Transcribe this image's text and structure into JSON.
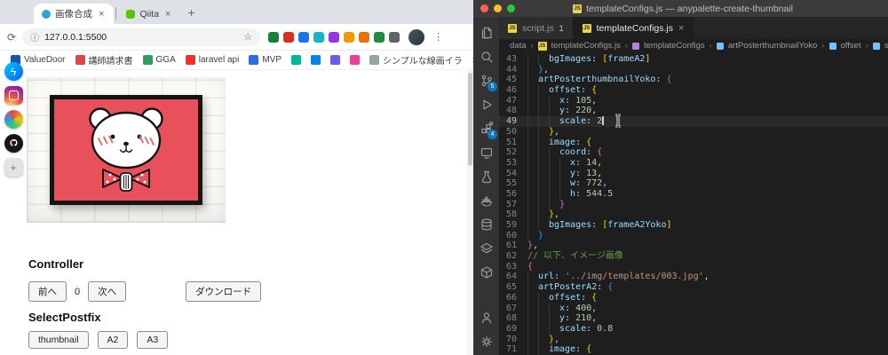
{
  "browser": {
    "tabs": [
      {
        "title": "画像合成",
        "favicon_color": "#2ea8c7"
      },
      {
        "title": "Qiita",
        "favicon_color": "#55c500"
      }
    ],
    "new_tab_label": "+",
    "url": "127.0.0.1:5500",
    "info_icon": "ⓘ",
    "star_icon": "☆",
    "reload_icon": "⟳",
    "menu_icon": "⋮",
    "extension_colors": [
      "#188038",
      "#d93025",
      "#1a73e8",
      "#12b5cb",
      "#9334e6",
      "#f29900",
      "#e8710a",
      "#1e8e3e",
      "#5f6368"
    ],
    "bookmarks": [
      {
        "label": "ValueDoor",
        "color": "#1a56a8"
      },
      {
        "label": "講師請求書",
        "color": "#e04545"
      },
      {
        "label": "GGA",
        "color": "#2e9e5b"
      },
      {
        "label": "laravel api",
        "color": "#ff2d20"
      },
      {
        "label": "MVP",
        "color": "#2d6cdf"
      },
      {
        "label": "",
        "color": "#00b894"
      },
      {
        "label": "",
        "color": "#0984e3"
      },
      {
        "label": "",
        "color": "#6c5ce7"
      },
      {
        "label": "",
        "color": "#e84393"
      },
      {
        "label": "シンプルな線画イラ",
        "color": "#95a5a6"
      },
      {
        "label": "»",
        "color": ""
      }
    ],
    "page": {
      "controller_heading": "Controller",
      "prev_button": "前へ",
      "counter": "0",
      "next_button": "次へ",
      "download_button": "ダウンロード",
      "postfix_heading": "SelectPostfix",
      "postfix_buttons": [
        "thumbnail",
        "A2",
        "A3"
      ]
    }
  },
  "dock": {
    "items": [
      "messenger",
      "instagram",
      "mission-control",
      "github",
      "add"
    ]
  },
  "vscode": {
    "window_title": "templateConfigs.js — anypalette-create-thumbnail",
    "tabs": [
      {
        "label": "script.js",
        "badge": "1"
      },
      {
        "label": "templateConfigs.js",
        "close": "×"
      }
    ],
    "breadcrumbs": [
      "data",
      "templateConfigs.js",
      "templateConfigs",
      "artPosterthumbnailYoko",
      "offset",
      "scale"
    ],
    "activity_badges": {
      "scm": "5",
      "extensions": "4"
    },
    "colors": {
      "k": "#9cdcfe",
      "n": "#b5cea8",
      "s": "#ce9178",
      "c": "#6a9955",
      "p": "#d4d4d4",
      "b1": "#ffd700",
      "b2": "#da70d6",
      "b3": "#179fff",
      "accent": "#1177bb",
      "editor_bg": "#1e1e1e"
    },
    "code": {
      "lines": [
        {
          "n": 43,
          "i": 4,
          "t": [
            [
              "k",
              "bgImages"
            ],
            [
              "p",
              ": "
            ],
            [
              "b1",
              "["
            ],
            [
              "k",
              "frameA2"
            ],
            [
              "b1",
              "]"
            ]
          ]
        },
        {
          "n": 44,
          "i": 2,
          "t": [
            [
              "b3",
              "}"
            ],
            [
              "p",
              ","
            ]
          ]
        },
        {
          "n": 45,
          "i": 2,
          "t": [
            [
              "k",
              "artPosterthumbnailYoko"
            ],
            [
              "p",
              ": "
            ],
            [
              "b3",
              "{"
            ]
          ]
        },
        {
          "n": 46,
          "i": 4,
          "t": [
            [
              "k",
              "offset"
            ],
            [
              "p",
              ": "
            ],
            [
              "b1",
              "{"
            ]
          ]
        },
        {
          "n": 47,
          "i": 6,
          "t": [
            [
              "k",
              "x"
            ],
            [
              "p",
              ": "
            ],
            [
              "n",
              "105"
            ],
            [
              "p",
              ","
            ]
          ]
        },
        {
          "n": 48,
          "i": 6,
          "t": [
            [
              "k",
              "y"
            ],
            [
              "p",
              ": "
            ],
            [
              "n",
              "220"
            ],
            [
              "p",
              ","
            ]
          ]
        },
        {
          "n": 49,
          "i": 6,
          "cur": true,
          "t": [
            [
              "k",
              "scale"
            ],
            [
              "p",
              ": "
            ],
            [
              "n",
              "2"
            ]
          ]
        },
        {
          "n": 50,
          "i": 4,
          "t": [
            [
              "b1",
              "}"
            ],
            [
              "p",
              ","
            ]
          ]
        },
        {
          "n": 51,
          "i": 4,
          "t": [
            [
              "k",
              "image"
            ],
            [
              "p",
              ": "
            ],
            [
              "b1",
              "{"
            ]
          ]
        },
        {
          "n": 52,
          "i": 6,
          "t": [
            [
              "k",
              "coord"
            ],
            [
              "p",
              ": "
            ],
            [
              "b2",
              "{"
            ]
          ]
        },
        {
          "n": 53,
          "i": 8,
          "t": [
            [
              "k",
              "x"
            ],
            [
              "p",
              ": "
            ],
            [
              "n",
              "14"
            ],
            [
              "p",
              ","
            ]
          ]
        },
        {
          "n": 54,
          "i": 8,
          "t": [
            [
              "k",
              "y"
            ],
            [
              "p",
              ": "
            ],
            [
              "n",
              "13"
            ],
            [
              "p",
              ","
            ]
          ]
        },
        {
          "n": 55,
          "i": 8,
          "t": [
            [
              "k",
              "w"
            ],
            [
              "p",
              ": "
            ],
            [
              "n",
              "772"
            ],
            [
              "p",
              ","
            ]
          ]
        },
        {
          "n": 56,
          "i": 8,
          "t": [
            [
              "k",
              "h"
            ],
            [
              "p",
              ": "
            ],
            [
              "n",
              "544.5"
            ]
          ]
        },
        {
          "n": 57,
          "i": 6,
          "t": [
            [
              "b2",
              "}"
            ]
          ]
        },
        {
          "n": 58,
          "i": 4,
          "t": [
            [
              "b1",
              "}"
            ],
            [
              "p",
              ","
            ]
          ]
        },
        {
          "n": 59,
          "i": 4,
          "t": [
            [
              "k",
              "bgImages"
            ],
            [
              "p",
              ": "
            ],
            [
              "b1",
              "["
            ],
            [
              "k",
              "frameA2Yoko"
            ],
            [
              "b1",
              "]"
            ]
          ]
        },
        {
          "n": 60,
          "i": 2,
          "t": [
            [
              "b3",
              "}"
            ]
          ]
        },
        {
          "n": 61,
          "i": 0,
          "t": [
            [
              "b2",
              "}"
            ],
            [
              "p",
              ","
            ]
          ]
        },
        {
          "n": 62,
          "i": 0,
          "t": [
            [
              "c",
              "// 以下、イメージ画像"
            ]
          ]
        },
        {
          "n": 63,
          "i": 0,
          "t": [
            [
              "b2",
              "{"
            ]
          ]
        },
        {
          "n": 64,
          "i": 2,
          "t": [
            [
              "k",
              "url"
            ],
            [
              "p",
              ": "
            ],
            [
              "s",
              "'../img/templates/003.jpg'"
            ],
            [
              "p",
              ","
            ]
          ]
        },
        {
          "n": 65,
          "i": 2,
          "t": [
            [
              "k",
              "artPosterA2"
            ],
            [
              "p",
              ": "
            ],
            [
              "b3",
              "{"
            ]
          ]
        },
        {
          "n": 66,
          "i": 4,
          "t": [
            [
              "k",
              "offset"
            ],
            [
              "p",
              ": "
            ],
            [
              "b1",
              "{"
            ]
          ]
        },
        {
          "n": 67,
          "i": 6,
          "t": [
            [
              "k",
              "x"
            ],
            [
              "p",
              ": "
            ],
            [
              "n",
              "400"
            ],
            [
              "p",
              ","
            ]
          ]
        },
        {
          "n": 68,
          "i": 6,
          "t": [
            [
              "k",
              "y"
            ],
            [
              "p",
              ": "
            ],
            [
              "n",
              "210"
            ],
            [
              "p",
              ","
            ]
          ]
        },
        {
          "n": 69,
          "i": 6,
          "t": [
            [
              "k",
              "scale"
            ],
            [
              "p",
              ": "
            ],
            [
              "n",
              "0.8"
            ]
          ]
        },
        {
          "n": 70,
          "i": 4,
          "t": [
            [
              "b1",
              "}"
            ],
            [
              "p",
              ","
            ]
          ]
        },
        {
          "n": 71,
          "i": 4,
          "t": [
            [
              "k",
              "image"
            ],
            [
              "p",
              ": "
            ],
            [
              "b1",
              "{"
            ]
          ]
        }
      ]
    }
  }
}
